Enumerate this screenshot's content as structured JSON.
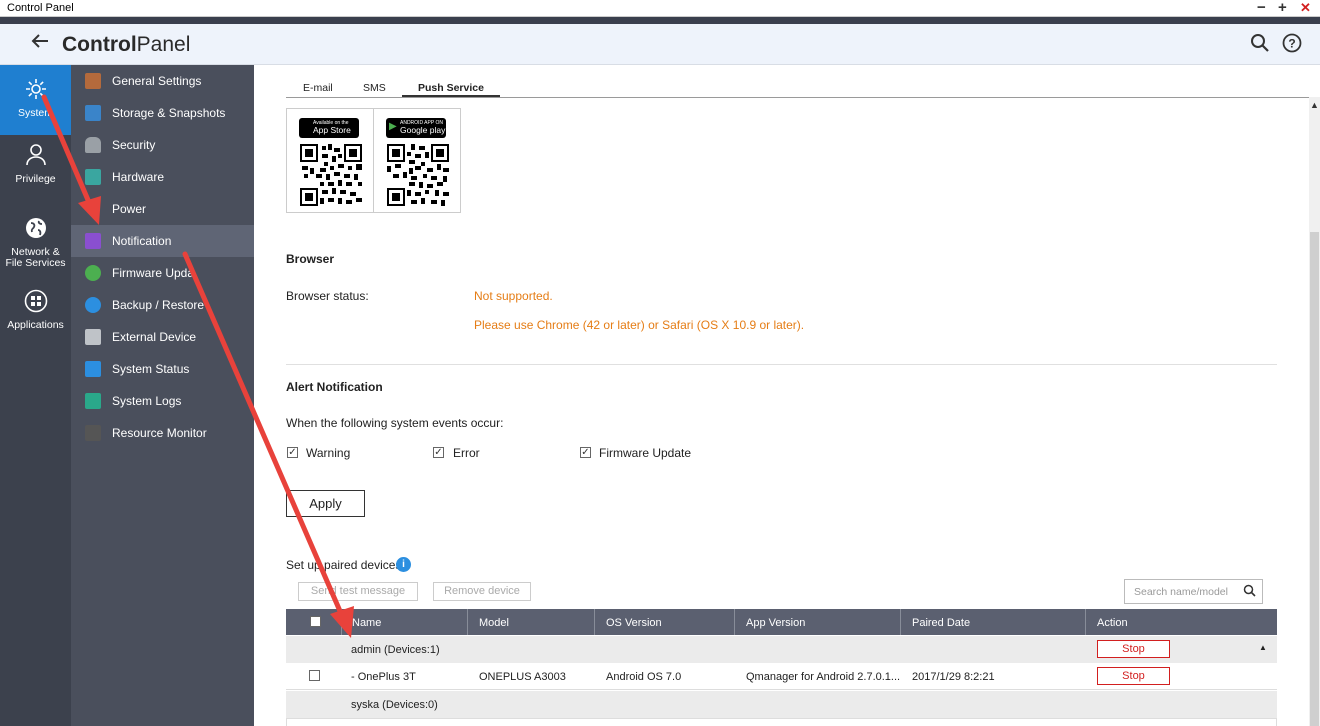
{
  "window": {
    "title": "Control Panel",
    "min": "−",
    "max": "+",
    "close": "✕"
  },
  "header": {
    "back_icon": "back-arrow-icon",
    "title_bold": "Control",
    "title_rest": "Panel",
    "search_icon": "search-icon",
    "help_icon": "help-icon"
  },
  "categories": [
    {
      "label": "System",
      "icon": "gear-icon",
      "active": true
    },
    {
      "label": "Privilege",
      "icon": "user-icon",
      "active": false
    },
    {
      "label": "Network &",
      "label2": "File Services",
      "icon": "globe-icon",
      "active": false
    },
    {
      "label": "Applications",
      "icon": "apps-grid-icon",
      "active": false
    }
  ],
  "nav": [
    {
      "label": "General Settings",
      "icon": "general-settings-icon",
      "color": "#b46a3c"
    },
    {
      "label": "Storage & Snapshots",
      "icon": "storage-icon",
      "color": "#3a84c9"
    },
    {
      "label": "Security",
      "icon": "lock-icon",
      "color": "#9aa0a6"
    },
    {
      "label": "Hardware",
      "icon": "hardware-icon",
      "color": "#3aa6a0"
    },
    {
      "label": "Power",
      "icon": "power-icon",
      "color": "#4a4f5c"
    },
    {
      "label": "Notification",
      "icon": "notification-icon",
      "color": "#8a4fd0",
      "active": true
    },
    {
      "label": "Firmware Upda",
      "icon": "firmware-icon",
      "color": "#4caf50"
    },
    {
      "label": "Backup / Restore",
      "icon": "backup-icon",
      "color": "#2c8fe0"
    },
    {
      "label": "External Device",
      "icon": "external-device-icon",
      "color": "#bfc3c8"
    },
    {
      "label": "System Status",
      "icon": "system-status-icon",
      "color": "#2c8fe0"
    },
    {
      "label": "System Logs",
      "icon": "system-logs-icon",
      "color": "#2aa88a"
    },
    {
      "label": "Resource Monitor",
      "icon": "resource-monitor-icon",
      "color": "#555"
    }
  ],
  "tabs": [
    {
      "label": "E-mail",
      "active": false
    },
    {
      "label": "SMS",
      "active": false
    },
    {
      "label": "Push Service",
      "active": true
    }
  ],
  "apps": {
    "appstore_small": "Available on the",
    "appstore": "App Store",
    "googleplay_small": "ANDROID APP ON",
    "googleplay": "Google play"
  },
  "browser": {
    "section_title": "Browser",
    "status_label": "Browser status:",
    "status_value": "Not supported.",
    "hint": "Please use Chrome (42 or later) or Safari (OS X 10.9 or later)."
  },
  "alert": {
    "section_title": "Alert Notification",
    "intro": "When the following system events occur:",
    "events": [
      {
        "label": "Warning",
        "checked": true
      },
      {
        "label": "Error",
        "checked": true
      },
      {
        "label": "Firmware Update",
        "checked": true
      }
    ],
    "apply_label": "Apply"
  },
  "devices": {
    "title": "Set up paired devices",
    "send_test": "Send test message",
    "remove": "Remove device",
    "search_placeholder": "Search name/model",
    "columns": [
      "Name",
      "Model",
      "OS Version",
      "App Version",
      "Paired Date",
      "Action"
    ],
    "groups": [
      {
        "name": "admin (Devices:1)",
        "action": "Stop",
        "rows": [
          {
            "name": "- OnePlus 3T",
            "model": "ONEPLUS A3003",
            "os": "Android OS 7.0",
            "app": "Qmanager for Android 2.7.0.1...",
            "date": "2017/1/29 8:2:21",
            "action": "Stop"
          }
        ]
      },
      {
        "name": "syska (Devices:0)",
        "rows": []
      }
    ]
  },
  "colors": {
    "accent": "#1f7fd0",
    "warning_text": "#e57d16",
    "stop_red": "#d21f1f",
    "annotation_arrow": "#e8423b"
  }
}
